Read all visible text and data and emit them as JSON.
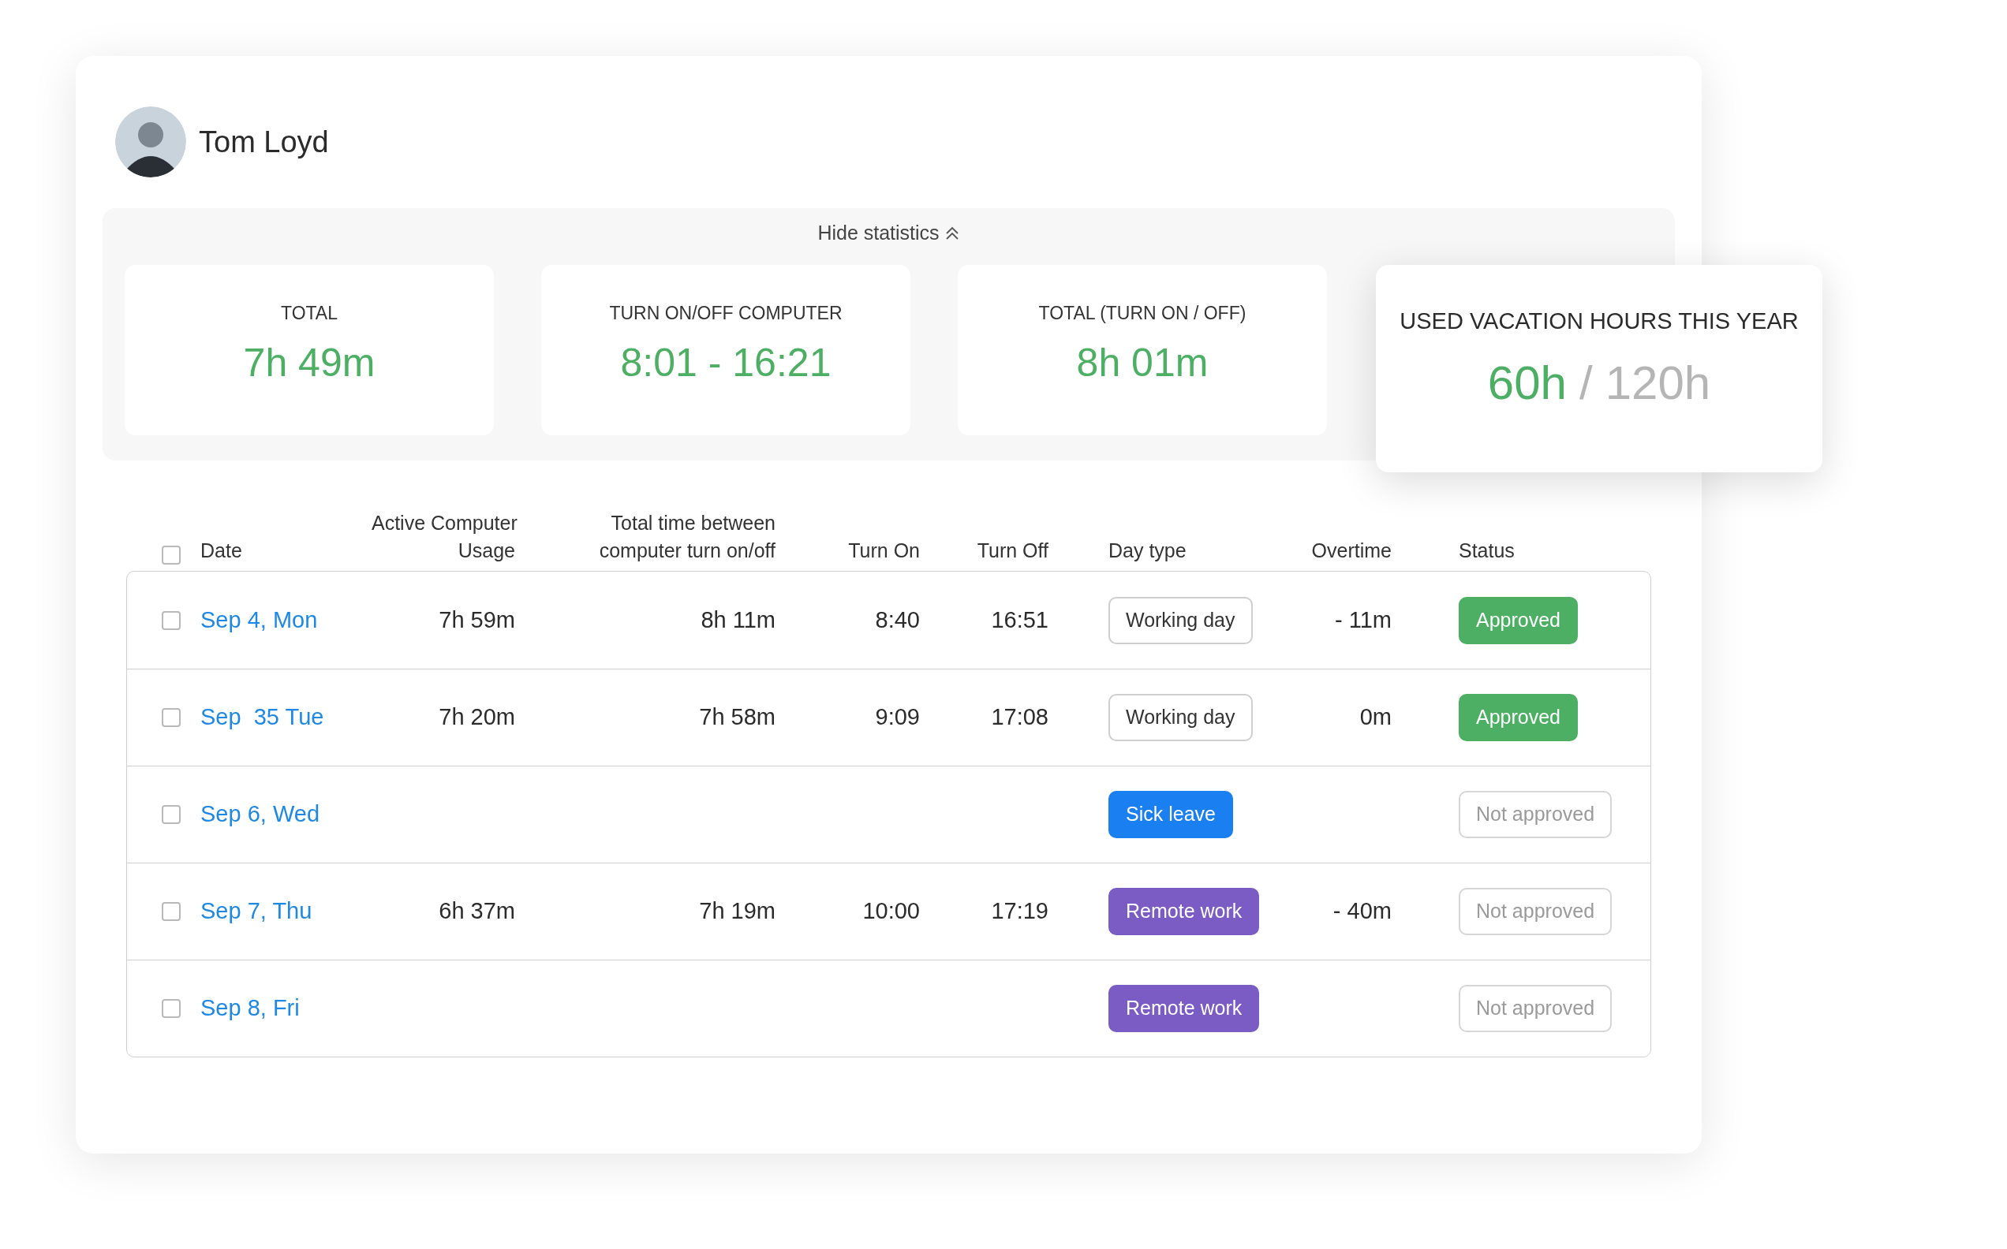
{
  "user": {
    "name": "Tom Loyd"
  },
  "statistics": {
    "toggle": "Hide statistics",
    "cards": [
      {
        "label": "TOTAL",
        "value": "7h 49m"
      },
      {
        "label": "TURN ON/OFF COMPUTER",
        "value": "8:01 - 16:21"
      },
      {
        "label": "TOTAL (TURN ON / OFF)",
        "value": "8h 01m"
      }
    ],
    "vacation": {
      "label": "USED VACATION HOURS THIS YEAR",
      "used": "60h",
      "separator": "/",
      "total": "120h"
    }
  },
  "table": {
    "select_all": {
      "checked": false
    },
    "columns": [
      [
        "Date"
      ],
      [
        "Active Computer",
        "Usage"
      ],
      [
        "Total time between",
        "computer turn on/off"
      ],
      [
        "Turn On"
      ],
      [
        "Turn Off"
      ],
      [
        "Day type"
      ],
      [
        "Overtime"
      ],
      [
        "Status"
      ]
    ],
    "rows": [
      {
        "checked": false,
        "date": "Sep 4, Mon",
        "active_usage": "7h 59m",
        "total_between": "8h 11m",
        "turn_on": "8:40",
        "turn_off": "16:51",
        "day_type": {
          "kind": "working",
          "label": "Working day"
        },
        "overtime": "- 11m",
        "status": {
          "approved": true,
          "label": "Approved"
        }
      },
      {
        "checked": false,
        "date": "Sep  35 Tue",
        "active_usage": "7h 20m",
        "total_between": "7h 58m",
        "turn_on": "9:09",
        "turn_off": "17:08",
        "day_type": {
          "kind": "working",
          "label": "Working day"
        },
        "overtime": "0m",
        "status": {
          "approved": true,
          "label": "Approved"
        }
      },
      {
        "checked": false,
        "date": "Sep 6, Wed",
        "day_type": {
          "kind": "sick",
          "label": "Sick leave"
        },
        "status": {
          "approved": false,
          "label": "Not approved"
        }
      },
      {
        "checked": false,
        "date": "Sep 7, Thu",
        "active_usage": "6h 37m",
        "total_between": "7h 19m",
        "turn_on": "10:00",
        "turn_off": "17:19",
        "day_type": {
          "kind": "remote",
          "label": "Remote work"
        },
        "overtime": "- 40m",
        "status": {
          "approved": false,
          "label": "Not approved"
        }
      },
      {
        "checked": false,
        "date": "Sep 8, Fri",
        "day_type": {
          "kind": "remote",
          "label": "Remote work"
        },
        "status": {
          "approved": false,
          "label": "Not approved"
        }
      }
    ]
  }
}
